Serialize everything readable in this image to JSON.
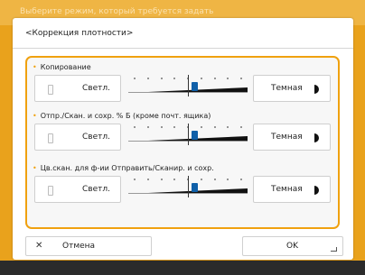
{
  "background": {
    "hint_text": "Выберите режим, который требуется задать"
  },
  "dialog": {
    "title": "<Коррекция плотности>"
  },
  "sections": [
    {
      "label": "Копирование",
      "light_label": "Светл.",
      "dark_label": "Темная",
      "level": 0.55
    },
    {
      "label": "Отпр./Скан. и сохр. % Б (кроме почт. ящика)",
      "light_label": "Светл.",
      "dark_label": "Темная",
      "level": 0.55
    },
    {
      "label": "Цв.скан. для ф-ии Отправить/Сканир. и сохр.",
      "light_label": "Светл.",
      "dark_label": "Темная",
      "level": 0.55
    }
  ],
  "footer": {
    "cancel_label": "Отмена",
    "ok_label": "OK"
  },
  "colors": {
    "accent": "#f0a10f",
    "thumb": "#0f5fa8",
    "background": "#e9a21c"
  },
  "icons": {
    "cancel": "close-icon",
    "ok": "enter-icon",
    "light": "light-lamp-icon",
    "dark": "dark-halfmoon-icon"
  }
}
